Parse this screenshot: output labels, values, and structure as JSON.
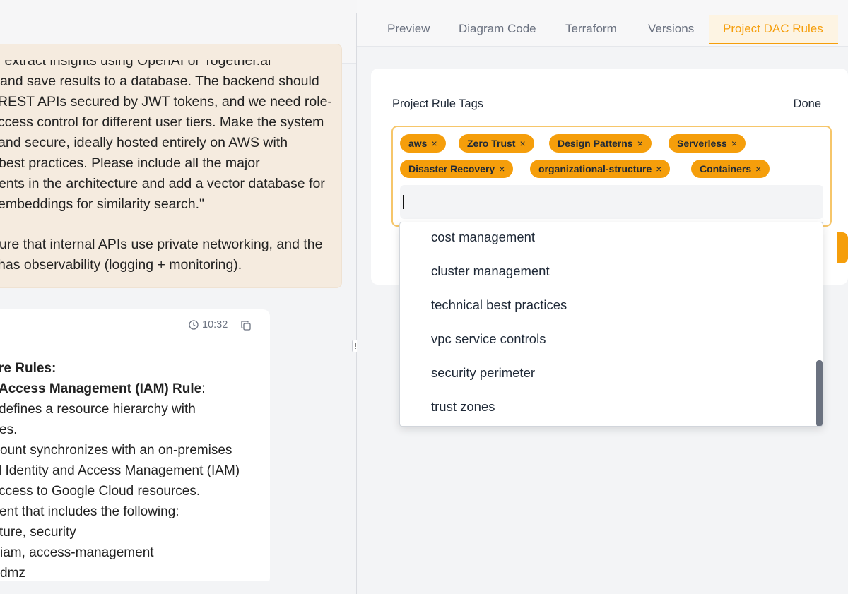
{
  "chat": {
    "user_message_lines": [
      "eally extract insights using OpenAI or Together.ai",
      "and save results to a database. The backend should",
      "REST APIs secured by JWT tokens, and we need role-",
      "ccess control for different user tiers. Make the system",
      " and secure, ideally hosted entirely on AWS with",
      "best practices. Please include all the major",
      "ents in the architecture and add a vector database for",
      "embeddings for similarity search.\"",
      "",
      "ure that internal APIs use private networking, and the",
      "has observability (logging + monitoring)."
    ],
    "assistant_time": "10:32",
    "assistant_lines": [
      {
        "text": "re Rules:",
        "bold": true
      },
      {
        "text": "Access Management (IAM) Rule",
        "bold": true,
        "suffix": ":"
      },
      {
        "text": "defines a resource hierarchy with",
        "bold": false
      },
      {
        "text": "es.",
        "bold": false
      },
      {
        "text": "ount synchronizes with an on-premises",
        "bold": false
      },
      {
        "text": "l Identity and Access Management (IAM)",
        "bold": false
      },
      {
        "text": "ccess to Google Cloud resources.",
        "bold": false
      },
      {
        "text": "ent that includes the following:",
        "bold": false
      },
      {
        "text": "ture, security",
        "bold": false
      },
      {
        "text": " iam, access-management",
        "bold": false
      },
      {
        "text": " dmz",
        "bold": false
      }
    ]
  },
  "tabs": [
    "Preview",
    "Diagram Code",
    "Terraform",
    "Versions",
    "Project DAC Rules"
  ],
  "active_tab": "Project DAC Rules",
  "rules_panel": {
    "title": "Project Rule Tags",
    "done_label": "Done",
    "tags": [
      "aws",
      "Zero Trust",
      "Design Patterns",
      "Serverless",
      "Disaster Recovery",
      "organizational-structure",
      "Containers"
    ],
    "input_value": "",
    "remove_symbol": "×"
  },
  "dropdown_options": [
    "cost management",
    "cluster management",
    "technical best practices",
    "vpc service controls",
    "security perimeter",
    "trust zones"
  ],
  "colors": {
    "accent": "#f59e0b",
    "user_bubble": "#f5ebdf"
  }
}
